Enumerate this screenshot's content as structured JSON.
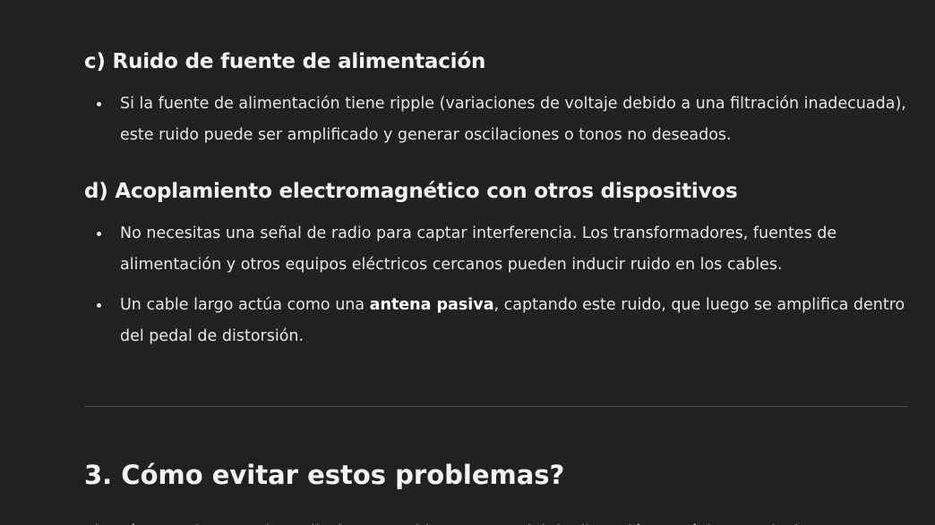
{
  "sections": {
    "c": {
      "heading": "c) Ruido de fuente de alimentación",
      "items": [
        {
          "text": "Si la fuente de alimentación tiene ripple (variaciones de voltaje debido a una filtración inadecuada), este ruido puede ser amplificado y generar oscilaciones o tonos no deseados."
        }
      ]
    },
    "d": {
      "heading": "d) Acoplamiento electromagnético con otros dispositivos",
      "items": [
        {
          "text": "No necesitas una señal de radio para captar interferencia. Los transformadores, fuentes de alimentación y otros equipos eléctricos cercanos pueden inducir ruido en los cables."
        },
        {
          "before": "Un cable largo actúa como una ",
          "bold": "antena pasiva",
          "after": ", captando este ruido, que luego se amplifica dentro del pedal de distorsión."
        }
      ]
    }
  },
  "section3": {
    "heading": "3. Cómo evitar estos problemas?",
    "cut_text": "Si estás experimentando oscilaciones o ruido con un pedal de distorsión, aquí tienes soluciones"
  }
}
